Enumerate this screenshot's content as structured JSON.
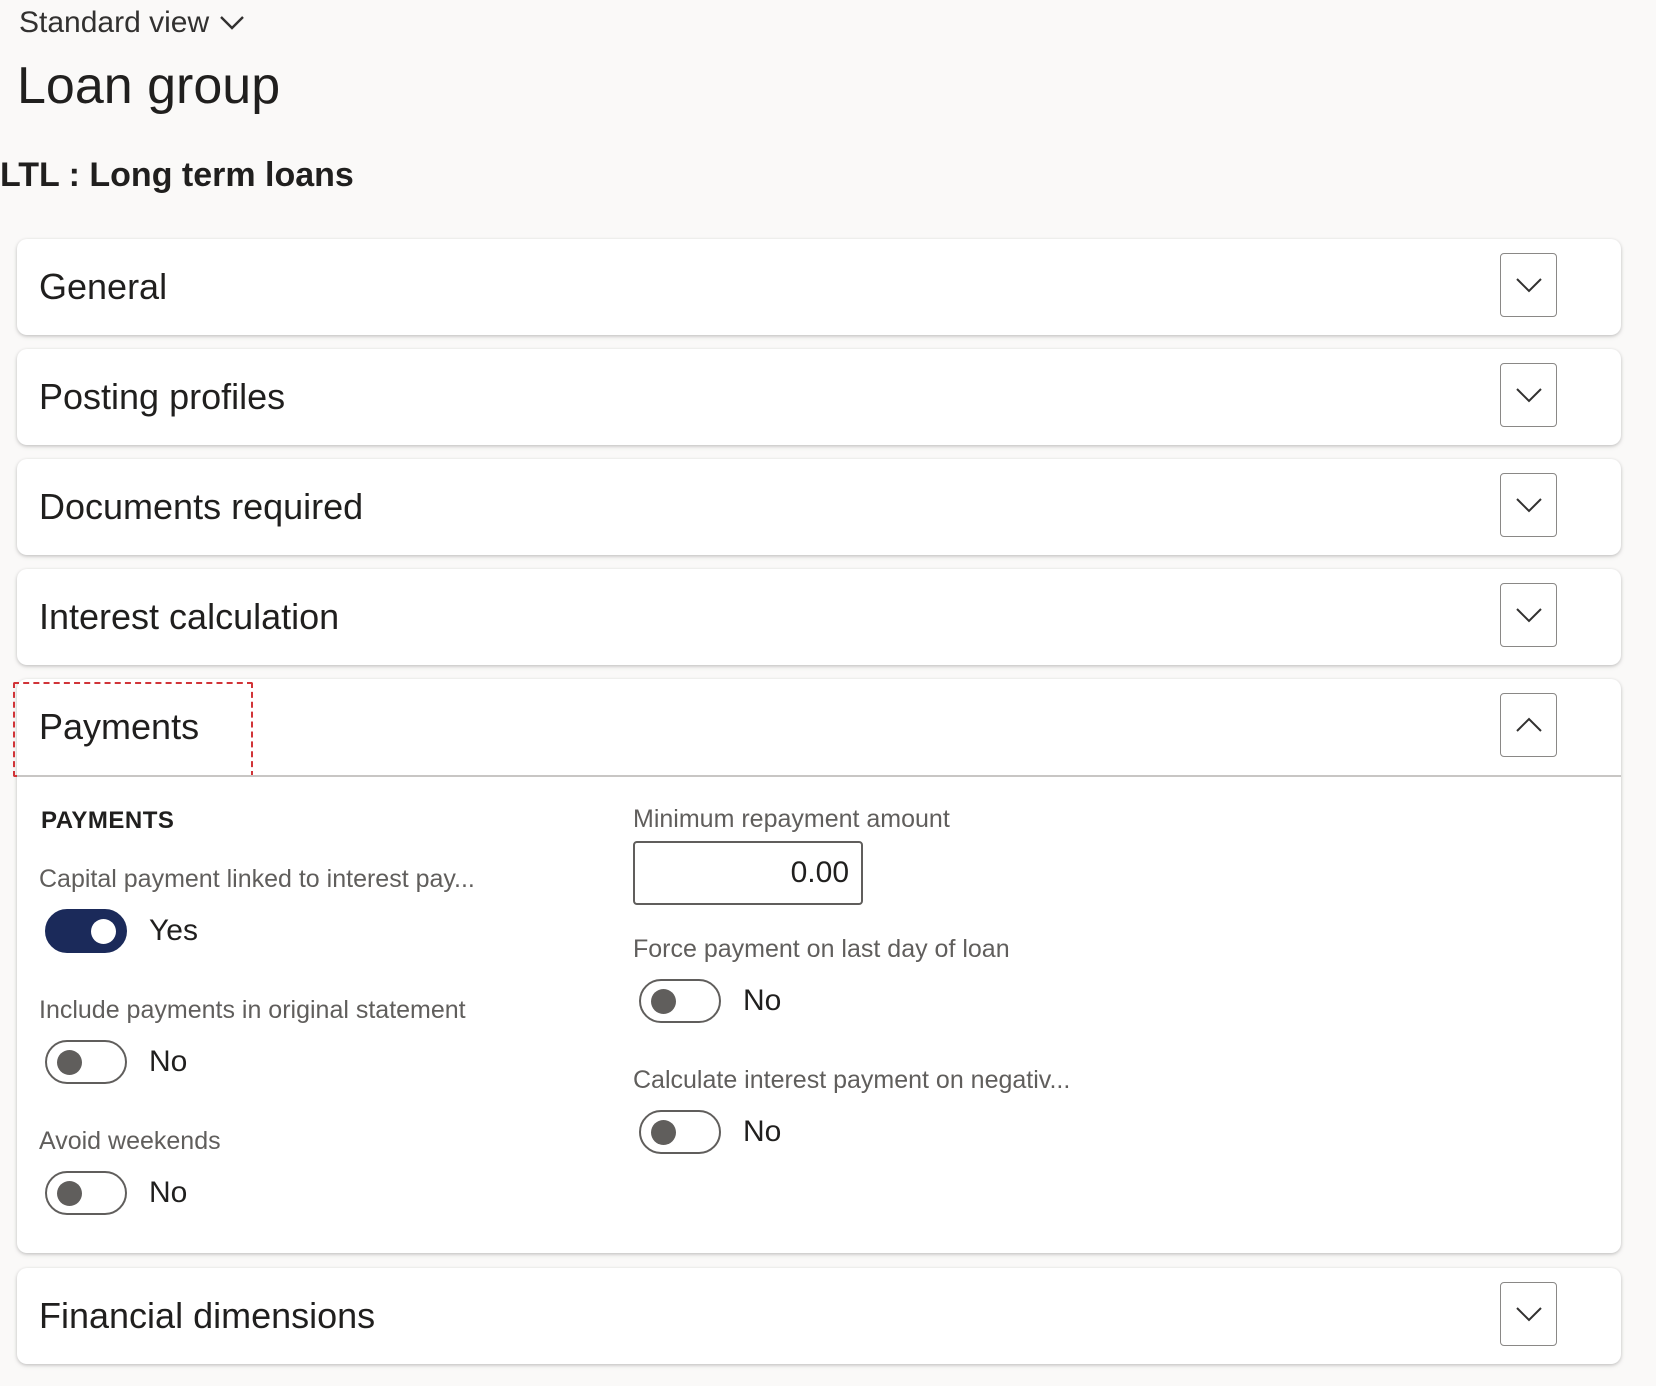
{
  "header": {
    "view_label": "Standard view",
    "page_title": "Loan group",
    "record_title": "LTL : Long term loans"
  },
  "fasttabs": [
    {
      "label": "General",
      "expanded": false
    },
    {
      "label": "Posting profiles",
      "expanded": false
    },
    {
      "label": "Documents required",
      "expanded": false
    },
    {
      "label": "Interest calculation",
      "expanded": false
    },
    {
      "label": "Payments",
      "expanded": true
    },
    {
      "label": "Financial dimensions",
      "expanded": false
    }
  ],
  "payments": {
    "group_label": "PAYMENTS",
    "capital_payment": {
      "label": "Capital payment linked to interest pay...",
      "value": "Yes",
      "on": true
    },
    "include_payments": {
      "label": "Include payments in original statement",
      "value": "No",
      "on": false
    },
    "avoid_weekends": {
      "label": "Avoid weekends",
      "value": "No",
      "on": false
    },
    "min_repayment": {
      "label": "Minimum repayment amount",
      "value": "0.00"
    },
    "force_payment": {
      "label": "Force payment on last day of loan",
      "value": "No",
      "on": false
    },
    "calc_interest": {
      "label": "Calculate interest payment on negativ...",
      "value": "No",
      "on": false
    }
  },
  "colors": {
    "toggle_on": "#1b2a5a",
    "highlight": "#d13438"
  }
}
